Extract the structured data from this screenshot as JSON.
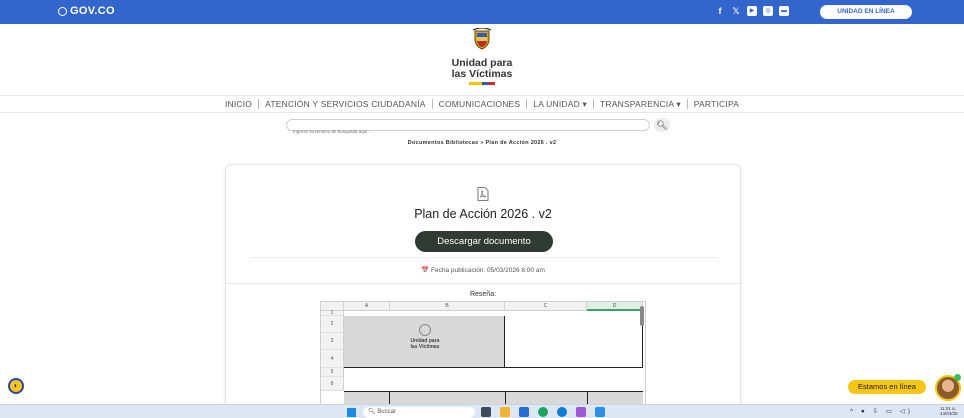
{
  "govbar": {
    "brand": "GOV.CO",
    "socials": [
      {
        "icon": "facebook-icon",
        "glyph": "f"
      },
      {
        "icon": "x-twitter-icon",
        "glyph": "𝕏"
      },
      {
        "icon": "youtube-icon",
        "glyph": "▶"
      },
      {
        "icon": "instagram-icon",
        "glyph": "◎"
      },
      {
        "icon": "message-icon",
        "glyph": "▬"
      }
    ],
    "online_button": "UNIDAD EN LÍNEA",
    "color": "#3366cc"
  },
  "logo": {
    "line1": "Unidad para",
    "line2": "las Víctimas"
  },
  "nav": {
    "items": [
      {
        "label": "INICIO"
      },
      {
        "label": "ATENCIÓN Y SERVICIOS CIUDADANÍA"
      },
      {
        "label": "COMUNICACIONES"
      },
      {
        "label": "LA UNIDAD ▾"
      },
      {
        "label": "TRANSPARENCIA ▾"
      },
      {
        "label": "PARTICIPA"
      }
    ]
  },
  "search": {
    "placeholder": "Ingrese su termino de busqueda aqui..."
  },
  "breadcrumb": "Documentos Bibliotecas » Plan de Acción 2026 . v2",
  "document": {
    "title": "Plan de Acción 2026 . v2",
    "download_label": "Descargar documento",
    "pub_date": "📅 Fecha publicación: 05/03/2026 8:00 am",
    "review_label": "Reseña:"
  },
  "sheet": {
    "columns": [
      "A",
      "B",
      "C",
      "D"
    ],
    "rows": [
      "1",
      "2",
      "3",
      "4",
      "5",
      "6"
    ],
    "logo_line1": "Unidad para",
    "logo_line2": "las Víctimas"
  },
  "floating": {
    "chat_label": "Estamos en línea"
  },
  "taskbar": {
    "search_label": "Buscar",
    "apps": [
      "#3d4a5c",
      "#f2b233",
      "#2a6bd6",
      "#1fa463",
      "#0f7bd4",
      "#9b59d6",
      "#2d8ee8"
    ],
    "tray": "^ ● ⇩ ▭ ◁)",
    "time": "11:01 a.",
    "date": "14/03/20"
  }
}
